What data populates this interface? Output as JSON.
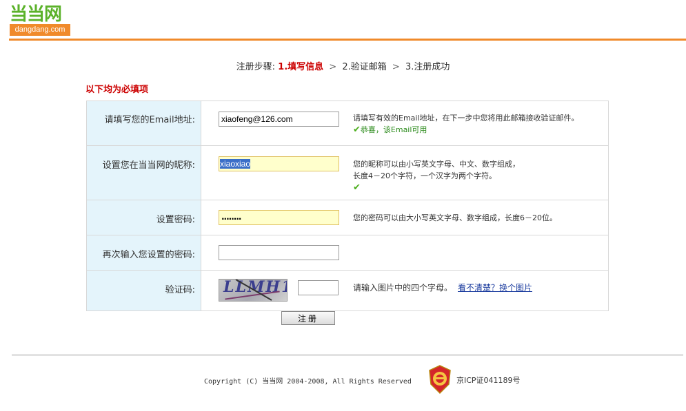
{
  "logo": {
    "name_cn": "当当网",
    "domain": "dangdang.com"
  },
  "steps": {
    "prefix": "注册步骤:",
    "step1": "1.填写信息",
    "sep": ">",
    "step2": "2.验证邮箱",
    "step3": "3.注册成功"
  },
  "required_note": "以下均为必填项",
  "form": {
    "email": {
      "label": "请填写您的Email地址:",
      "value": "xiaofeng@126.com",
      "hint": "请填写有效的Email地址，在下一步中您将用此邮箱接收验证邮件。",
      "ok": "恭喜，该Email可用"
    },
    "nickname": {
      "label": "设置您在当当网的昵称:",
      "value": "xiaoxiao",
      "hint1": "您的昵称可以由小写英文字母、中文、数字组成，",
      "hint2": "长度4－20个字符，一个汉字为两个字符。"
    },
    "password": {
      "label": "设置密码:",
      "value": "........",
      "hint": "您的密码可以由大小写英文字母、数字组成，长度6－20位。"
    },
    "confirm": {
      "label": "再次输入您设置的密码:",
      "value": ""
    },
    "captcha": {
      "label": "验证码:",
      "image_text": "LLMH1",
      "value": "",
      "hint": "请输入图片中的四个字母。",
      "link": "看不清楚？换个图片"
    }
  },
  "submit_label": "注册",
  "footer": {
    "copyright": "Copyright (C) 当当网 2004-2008, All Rights Reserved",
    "icp": "京ICP证041189号"
  },
  "colors": {
    "brand_green": "#5bb22a",
    "brand_orange": "#f08a2a",
    "label_bg": "#e4f4fb",
    "alert_red": "#cc0000"
  }
}
